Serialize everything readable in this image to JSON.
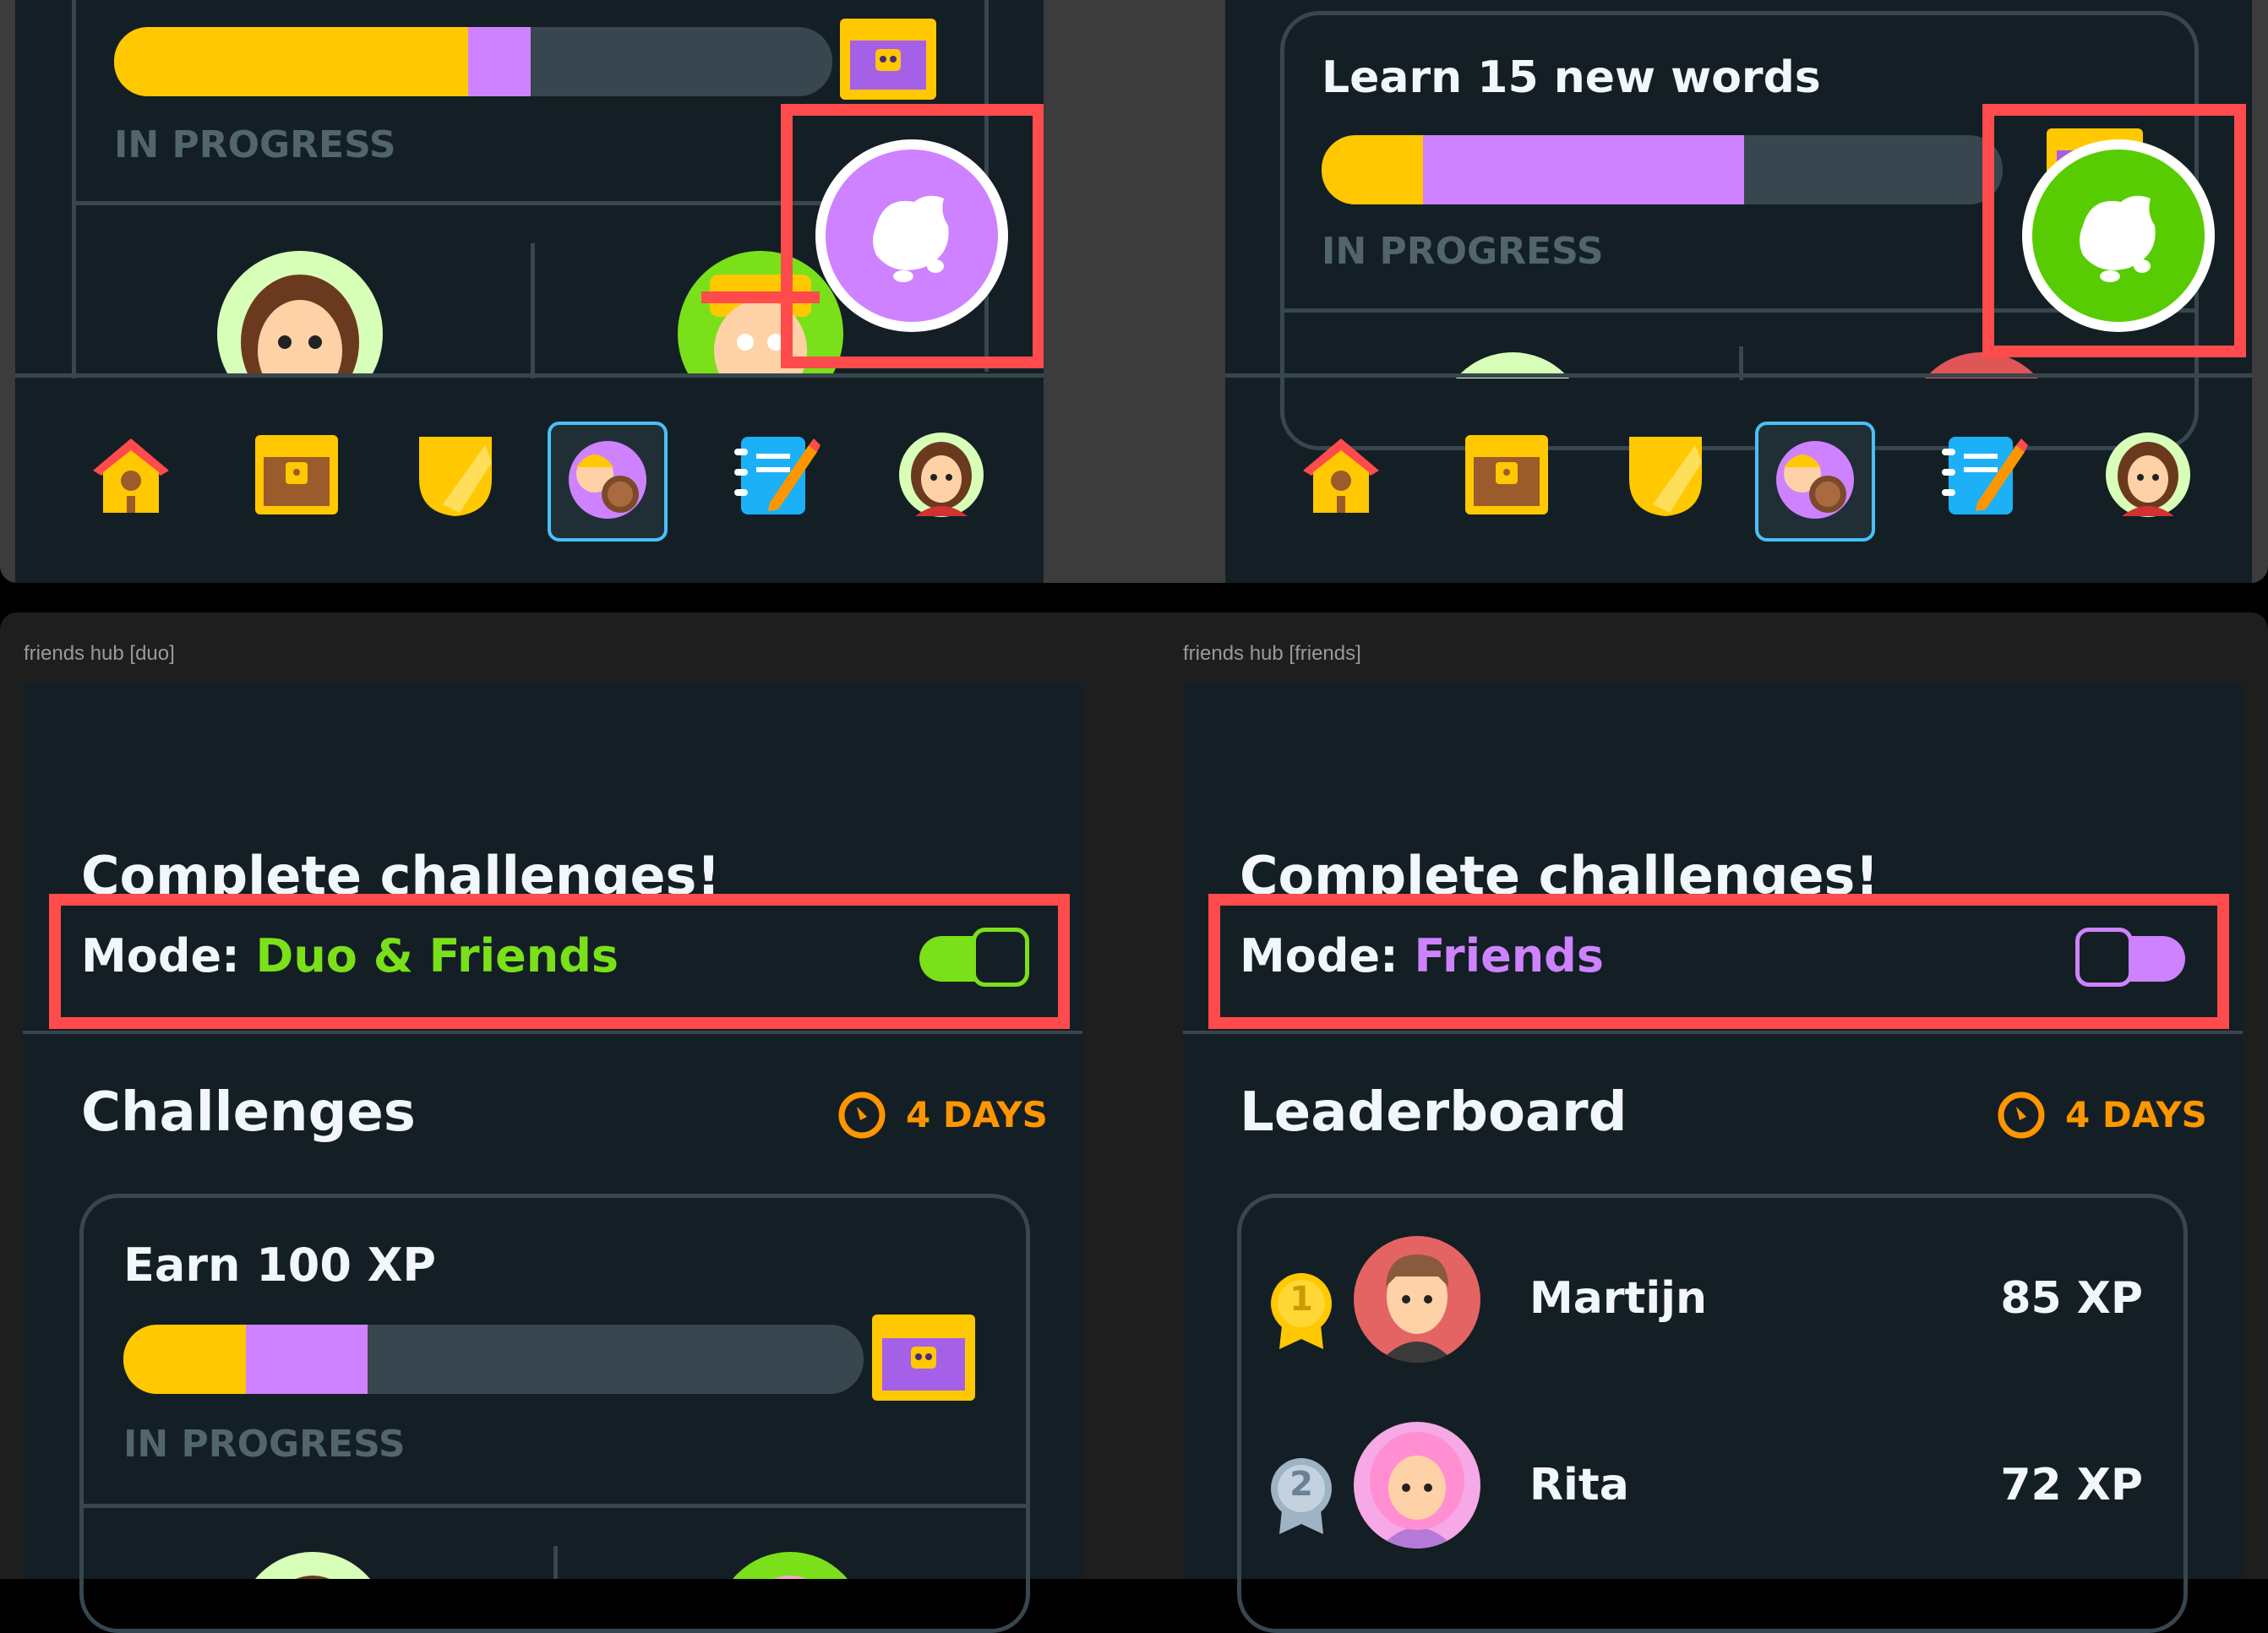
{
  "top_left": {
    "status": "IN PROGRESS",
    "progress": 0.58
  },
  "top_right": {
    "challenge_title": "Learn 15 new words",
    "status": "IN PROGRESS",
    "progress": 0.62
  },
  "nav": {
    "items": [
      "home-icon",
      "treasure-chest-icon",
      "league-shield-icon",
      "friends-icon",
      "notebook-icon",
      "profile-avatar-icon"
    ],
    "active": "friends-icon"
  },
  "frame_duo": {
    "label": "friends hub [duo]",
    "heading": "Complete challenges!",
    "mode_prefix": "Mode:",
    "mode_value": "Duo & Friends",
    "section_title": "Challenges",
    "timer": "4 DAYS",
    "card_title": "Earn 100 XP",
    "card_status": "IN PROGRESS",
    "progress": 0.33
  },
  "frame_friends": {
    "label": "friends hub [friends]",
    "heading": "Complete challenges!",
    "mode_prefix": "Mode:",
    "mode_value": "Friends",
    "section_title": "Leaderboard",
    "timer": "4 DAYS",
    "rows": [
      {
        "rank": "1",
        "name": "Martijn",
        "xp": "85 XP"
      },
      {
        "rank": "2",
        "name": "Rita",
        "xp": "72 XP"
      }
    ]
  },
  "colors": {
    "highlight": "#ff4b4b",
    "green": "#7ae01a",
    "purple": "#ce82ff",
    "gold": "#ffc800",
    "orange": "#ff9600",
    "background": "#131f24"
  }
}
